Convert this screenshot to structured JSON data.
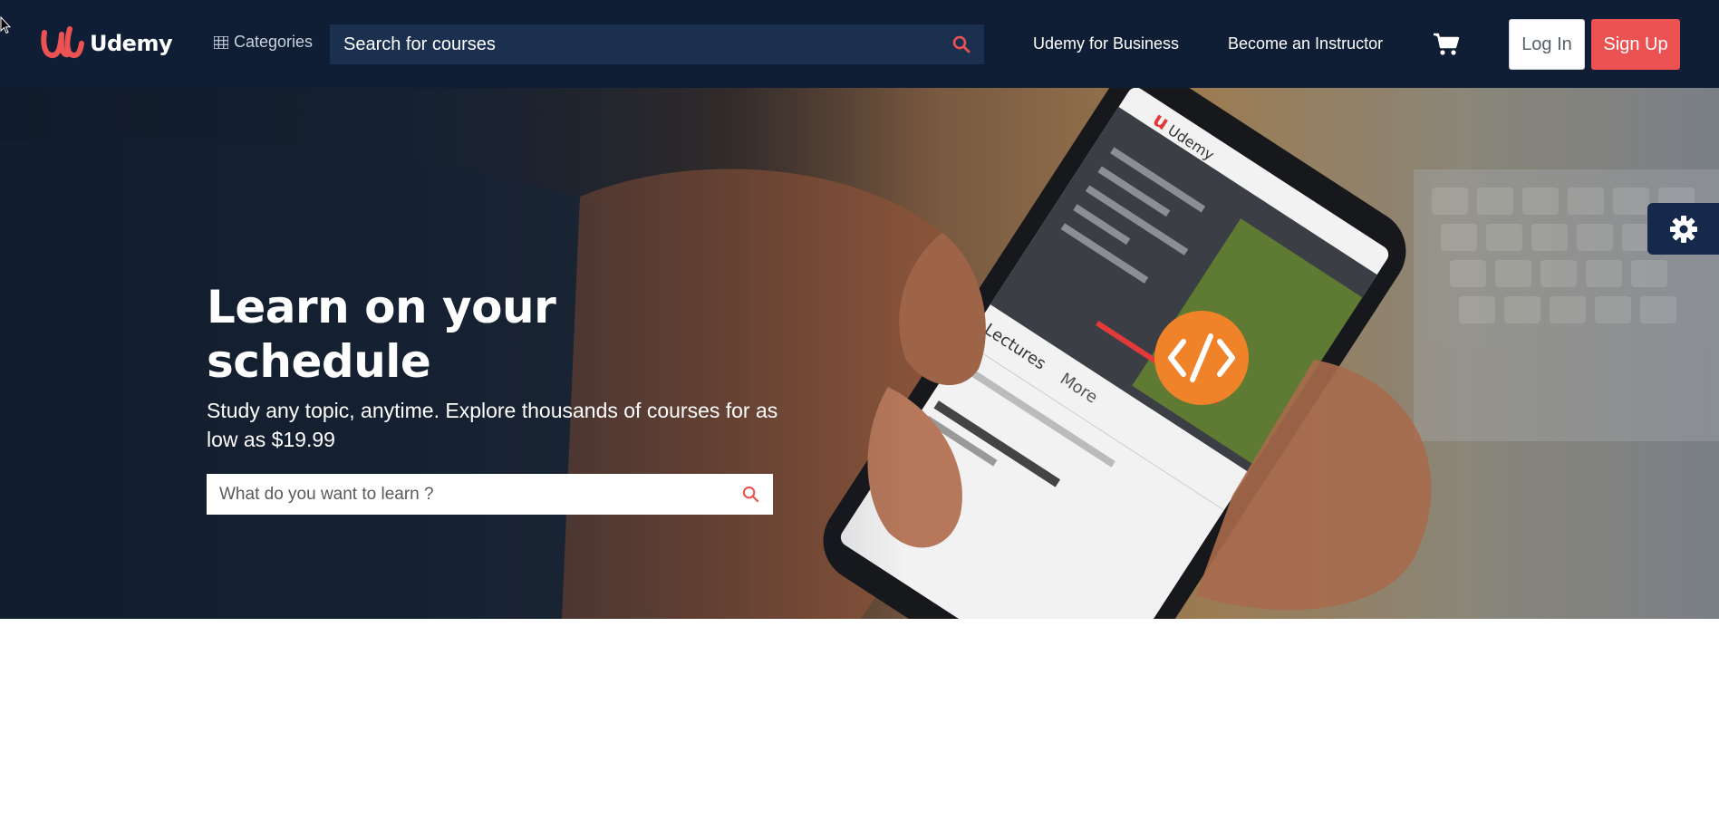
{
  "header": {
    "logo_text": "Udemy",
    "categories_label": "Categories",
    "search_placeholder": "Search for courses",
    "links": {
      "business": "Udemy for Business",
      "instructor": "Become an Instructor"
    },
    "login_label": "Log In",
    "signup_label": "Sign Up"
  },
  "hero": {
    "title": "Learn on your schedule",
    "subtitle": "Study any topic, anytime. Explore thousands of courses for as low as $19.99",
    "search_placeholder": "What do you want to learn ?"
  },
  "icons": {
    "grid": "grid-icon",
    "search": "search-icon",
    "cart": "cart-icon",
    "settings": "gear-icon"
  },
  "colors": {
    "navbar_bg": "#0f1e35",
    "search_bg": "#1b2f4f",
    "accent_red": "#ec5252",
    "settings_bg": "#14294b"
  }
}
